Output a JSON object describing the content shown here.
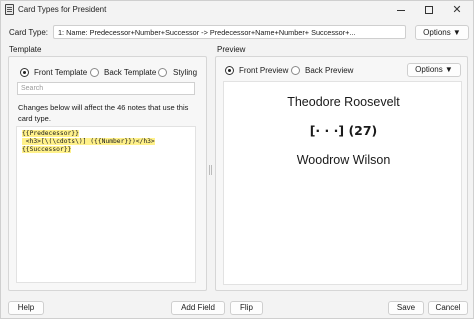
{
  "window": {
    "title": "Card Types for President",
    "minimize_glyph": "",
    "close_glyph": "✕"
  },
  "card_type": {
    "label": "Card Type:",
    "selected": "1: Name: Predecessor+Number+Successor -> Predecessor+Name+Number+ Successor+...",
    "options_label": "Options ▼"
  },
  "template": {
    "group_label": "Template",
    "radios": [
      {
        "label": "Front Template",
        "selected": true
      },
      {
        "label": "Back Template",
        "selected": false
      },
      {
        "label": "Styling",
        "selected": false
      }
    ],
    "search_placeholder": "Search",
    "notice": "Changes below will affect the 46 notes that use this card type.",
    "code_lines": [
      "{{Predecessor}}",
      " <h3>[\\(\\cdots\\)] ({{Number}})</h3>",
      "{{Successor}}"
    ]
  },
  "preview": {
    "group_label": "Preview",
    "radios": [
      {
        "label": "Front Preview",
        "selected": true
      },
      {
        "label": "Back Preview",
        "selected": false
      }
    ],
    "options_label": "Options ▼",
    "line1": "Theodore Roosevelt",
    "line2": "[· · ·] (27)",
    "line3": "Woodrow Wilson"
  },
  "buttons": {
    "help": "Help",
    "add_field": "Add Field",
    "flip": "Flip",
    "save": "Save",
    "cancel": "Cancel"
  }
}
